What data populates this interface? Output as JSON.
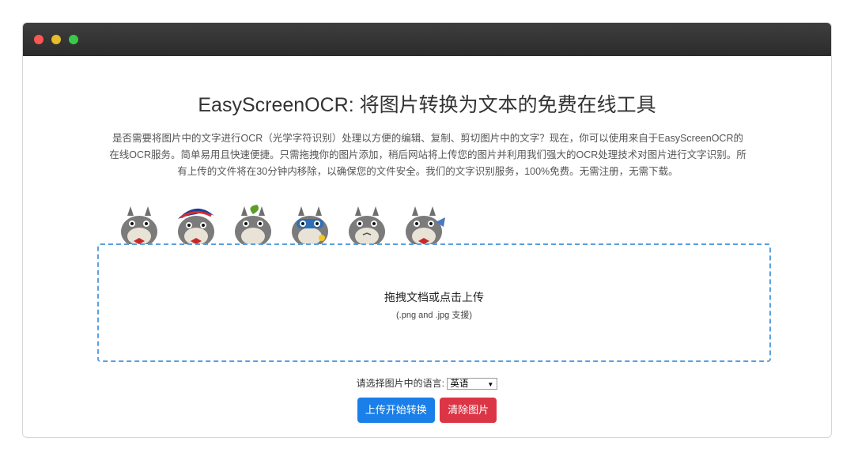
{
  "heading": "EasyScreenOCR: 将图片转换为文本的免费在线工具",
  "description": "是否需要将图片中的文字进行OCR（光学字符识别）处理以方便的编辑、复制、剪切图片中的文字？现在，你可以使用来自于EasyScreenOCR的在线OCR服务。简单易用且快速便捷。只需拖拽你的图片添加，稍后网站将上传您的图片并利用我们强大的OCR处理技术对图片进行文字识别。所有上传的文件将在30分钟内移除，以确保您的文件安全。我们的文字识别服务，100%免费。无需注册，无需下载。",
  "dropzone": {
    "title": "拖拽文档或点击上传",
    "subtitle": "(.png and .jpg 支援)"
  },
  "language": {
    "label": "请选择图片中的语言:",
    "selected": "英语"
  },
  "buttons": {
    "upload": "上传开始转换",
    "clear": "清除图片"
  },
  "colors": {
    "primary": "#1a7fe8",
    "danger": "#dc3545",
    "dropzone_border": "#5aa0e0"
  }
}
